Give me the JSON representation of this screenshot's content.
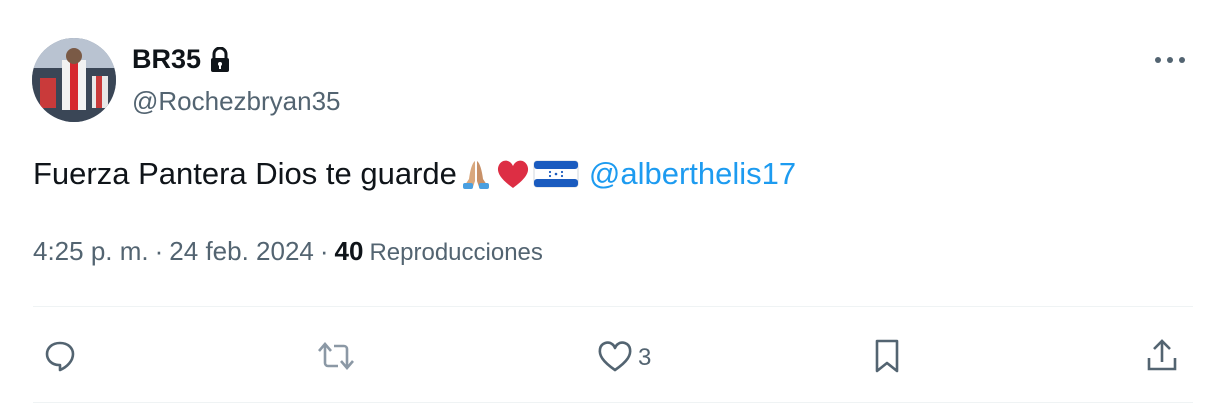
{
  "author": {
    "display_name": "BR35",
    "handle": "@Rochezbryan35",
    "protected": true
  },
  "tweet": {
    "text": "Fuerza Pantera Dios te guarde",
    "emojis": [
      "folded-hands",
      "red-heart",
      "flag-honduras"
    ],
    "mention": "@alberthelis17"
  },
  "meta": {
    "time": "4:25 p. m.",
    "separator1": "·",
    "date": "24 feb. 2024",
    "separator2": "·",
    "views_count": "40",
    "views_label": "Reproducciones"
  },
  "actions": {
    "likes": "3"
  },
  "colors": {
    "text": "#0f1419",
    "secondary": "#536471",
    "link": "#1d9bf0",
    "divider": "#eff3f4"
  },
  "icons": [
    "lock-icon",
    "more-icon",
    "reply-icon",
    "retweet-icon",
    "like-icon",
    "bookmark-icon",
    "share-icon"
  ]
}
